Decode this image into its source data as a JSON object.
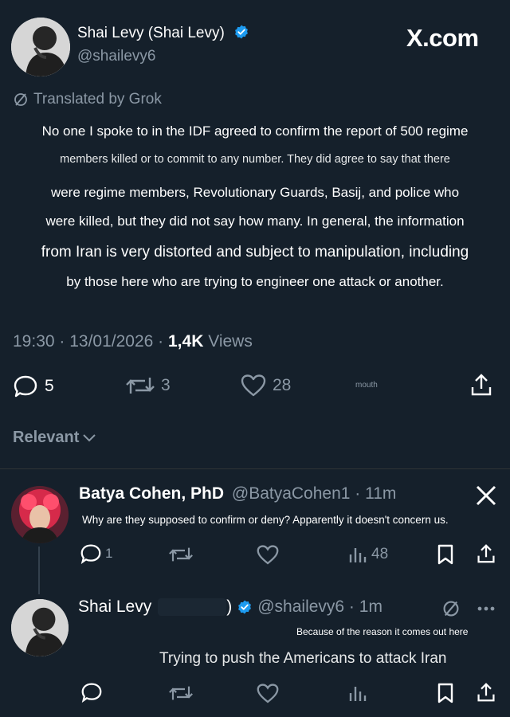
{
  "main_tweet": {
    "display_name": "Shai Levy (Shai Levy)",
    "handle": "@shailevy6",
    "brand": "X.com",
    "translated_label": "Translated by Grok",
    "text_lines": [
      "No one I spoke to in the IDF agreed to confirm the report of 500 regime",
      "members killed or to commit to any number. They did agree to say that there",
      "were regime members, Revolutionary Guards, Basij, and police who",
      "were killed, but they did not say how many. In general, the information",
      "from Iran is very distorted and subject to manipulation, including",
      "by those here who are trying to engineer one attack or another."
    ],
    "timestamp": "19:30 · 13/01/2026 ·",
    "views_count": "1,4K",
    "views_label": "Views",
    "replies": "5",
    "reposts": "3",
    "likes": "28",
    "small_label": "mouth"
  },
  "sort": {
    "label": "Relevant"
  },
  "reply1": {
    "display_name": "Batya Cohen, PhD",
    "handle_time": "@BatyaCohen1 · 11m",
    "text": "Why are they supposed to confirm or deny? Apparently it doesn't concern us.",
    "replies": "1",
    "views": "48"
  },
  "reply2": {
    "display_name": "Shai Levy",
    "paren": ")",
    "handle_time": "@shailevy6 · 1m",
    "caption": "Because of the reason it comes out here",
    "text": "Trying to push the Americans to attack Iran"
  },
  "colors": {
    "background": "#15202b",
    "text": "#e7e9ea",
    "muted": "#8b98a5",
    "verified": "#1d9bf0"
  }
}
